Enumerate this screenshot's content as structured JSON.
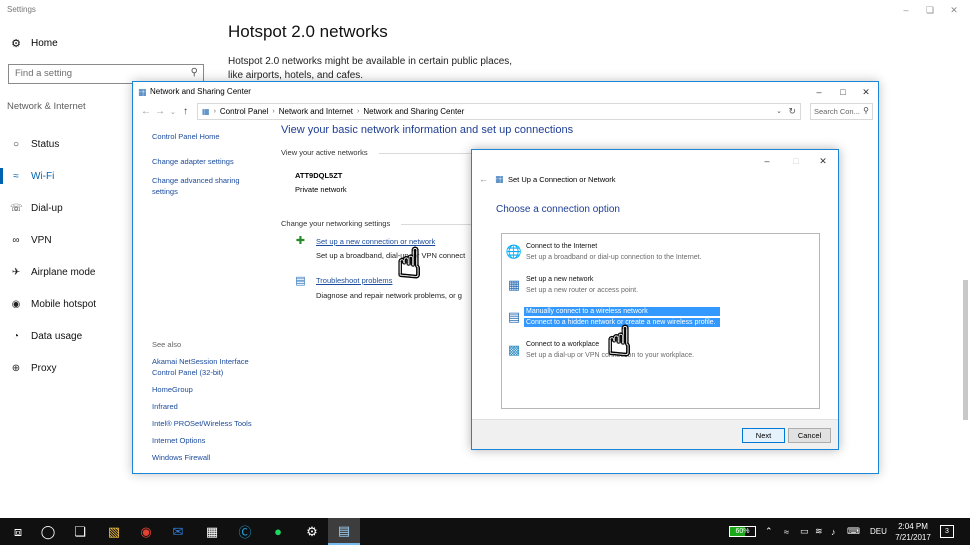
{
  "settings": {
    "app_title": "Settings",
    "home_label": "Home",
    "search_placeholder": "Find a setting",
    "section_header": "Network & Internet",
    "nav_items": [
      {
        "label": "Status",
        "icon": "globe-icon"
      },
      {
        "label": "Wi-Fi",
        "icon": "wifi-icon",
        "active": true
      },
      {
        "label": "Dial-up",
        "icon": "dialup-icon"
      },
      {
        "label": "VPN",
        "icon": "vpn-icon"
      },
      {
        "label": "Airplane mode",
        "icon": "airplane-icon"
      },
      {
        "label": "Mobile hotspot",
        "icon": "hotspot-icon"
      },
      {
        "label": "Data usage",
        "icon": "data-usage-icon"
      },
      {
        "label": "Proxy",
        "icon": "globe-icon"
      }
    ],
    "page_title": "Hotspot 2.0 networks",
    "page_description": "Hotspot 2.0 networks might be available in certain public places, like airports, hotels, and cafes.",
    "accent_color": "#0063b1"
  },
  "nsc": {
    "title": "Network and Sharing Center",
    "breadcrumb": [
      "Control Panel",
      "Network and Internet",
      "Network and Sharing Center"
    ],
    "search_placeholder": "Search Con...",
    "side_links": [
      "Control Panel Home",
      "Change adapter settings",
      "Change advanced sharing settings"
    ],
    "see_also_label": "See also",
    "see_also_links": [
      "Akamai NetSession Interface Control Panel (32-bit)",
      "HomeGroup",
      "Infrared",
      "Intel® PROSet/Wireless Tools",
      "Internet Options",
      "Windows Firewall"
    ],
    "heading": "View your basic network information and set up connections",
    "active_networks_label": "View your active networks",
    "network_name": "ATT9DQL5ZT",
    "network_type": "Private network",
    "change_settings_label": "Change your networking settings",
    "tasks": [
      {
        "link": "Set up a new connection or network",
        "desc": "Set up a broadband, dial-up, or VPN connect"
      },
      {
        "link": "Troubleshoot problems",
        "desc": "Diagnose and repair network problems, or g"
      }
    ]
  },
  "setup": {
    "title": "Set Up a Connection or Network",
    "heading": "Choose a connection option",
    "options": [
      {
        "title": "Connect to the Internet",
        "desc": "Set up a broadband or dial-up connection to the Internet."
      },
      {
        "title": "Set up a new network",
        "desc": "Set up a new router or access point."
      },
      {
        "title": "Manually connect to a wireless network",
        "desc": "Connect to a hidden network or create a new wireless profile.",
        "selected": true
      },
      {
        "title": "Connect to a workplace",
        "desc": "Set up a dial-up or VPN connection to your workplace."
      }
    ],
    "next_label": "Next",
    "cancel_label": "Cancel",
    "selection_color": "#3399ff"
  },
  "taskbar": {
    "battery": "60%",
    "language": "DEU",
    "time": "2:04 PM",
    "date": "7/21/2017",
    "notification_count": "3"
  }
}
